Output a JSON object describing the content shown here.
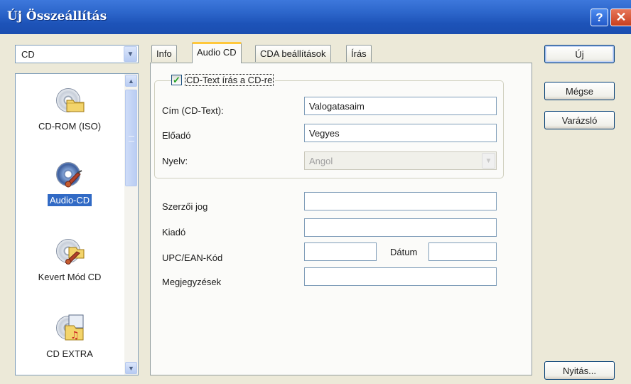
{
  "window": {
    "title": "Új Összeállítás",
    "help_glyph": "?",
    "close_glyph": "✕"
  },
  "project_type": {
    "selected": "CD"
  },
  "project_list": {
    "items": [
      {
        "label": "CD-ROM (ISO)",
        "icon": "cd-rom-icon"
      },
      {
        "label": "Audio-CD",
        "icon": "audio-cd-icon",
        "selected": true
      },
      {
        "label": "Kevert Mód CD",
        "icon": "mixed-mode-cd-icon"
      },
      {
        "label": "CD EXTRA",
        "icon": "cd-extra-icon"
      }
    ]
  },
  "tabs": [
    "Info",
    "Audio CD",
    "CDA beállítások",
    "Írás"
  ],
  "active_tab": "Audio CD",
  "cd_text": {
    "checkbox_label": "CD-Text írás a CD-re",
    "checked": true,
    "title_label": "Cím (CD-Text):",
    "title_value": "Valogatasaim",
    "artist_label": "Előadó",
    "artist_value": "Vegyes",
    "language_label": "Nyelv:",
    "language_value": "Angol"
  },
  "fields": {
    "copyright_label": "Szerzői jog",
    "copyright_value": "",
    "publisher_label": "Kiadó",
    "publisher_value": "",
    "upc_label": "UPC/EAN-Kód",
    "upc_value": "",
    "date_label": "Dátum",
    "date_value": "",
    "notes_label": "Megjegyzések",
    "notes_value": ""
  },
  "buttons": {
    "new": "Új",
    "cancel": "Mégse",
    "wizard": "Varázsló",
    "open": "Nyitás..."
  },
  "colors": {
    "titlebar": "#2b64c9",
    "selection": "#316ac5",
    "tab_highlight": "#ffc83c",
    "face": "#ece9d8"
  }
}
